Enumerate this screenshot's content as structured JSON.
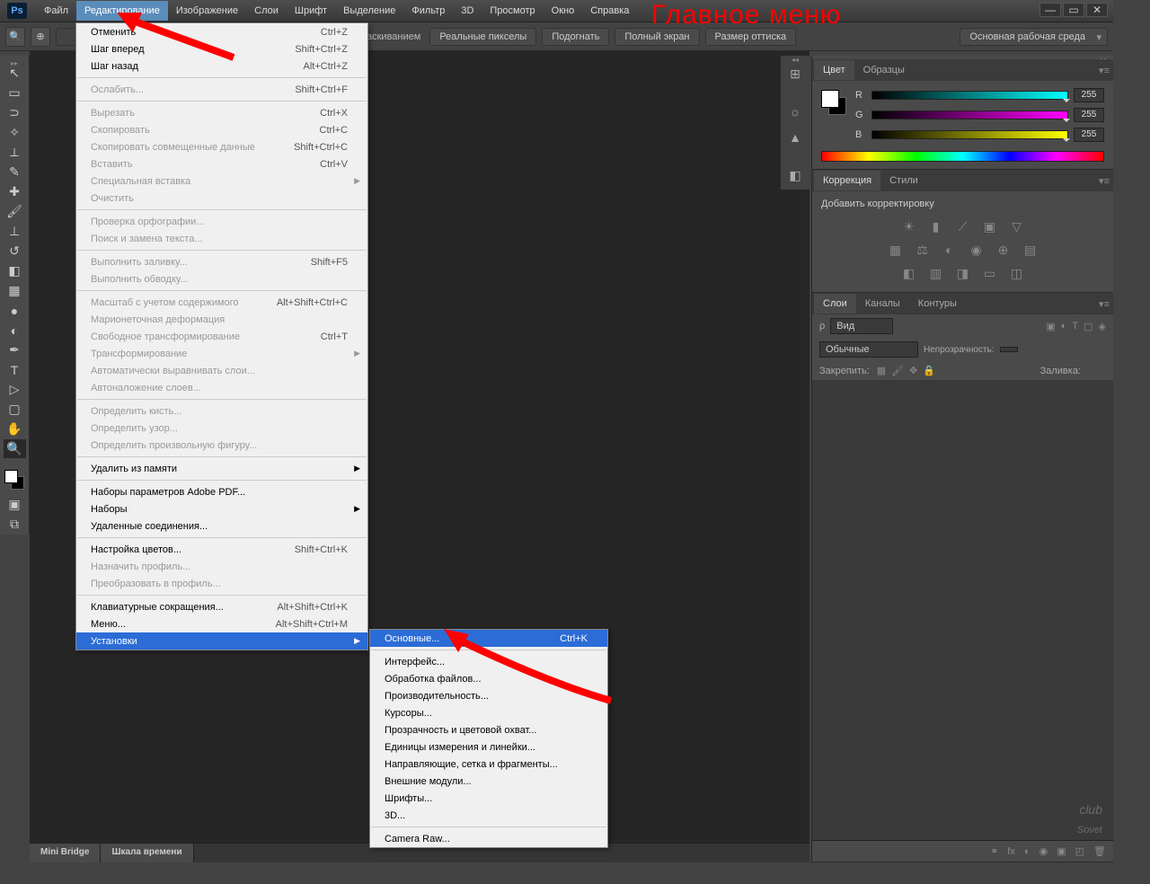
{
  "annotation": "Главное меню",
  "menubar": [
    "Файл",
    "Редактирование",
    "Изображение",
    "Слои",
    "Шрифт",
    "Выделение",
    "Фильтр",
    "3D",
    "Просмотр",
    "Окно",
    "Справка"
  ],
  "optbar": {
    "lbl1": "аскиванием",
    "btns": [
      "Реальные пикселы",
      "Подогнать",
      "Полный экран",
      "Размер оттиска"
    ],
    "workspace": "Основная рабочая среда"
  },
  "dropdown_edit": [
    {
      "t": "row",
      "label": "Отменить",
      "sc": "Ctrl+Z"
    },
    {
      "t": "row",
      "label": "Шаг вперед",
      "sc": "Shift+Ctrl+Z"
    },
    {
      "t": "row",
      "label": "Шаг назад",
      "sc": "Alt+Ctrl+Z"
    },
    {
      "t": "sep"
    },
    {
      "t": "row",
      "label": "Ослабить...",
      "sc": "Shift+Ctrl+F",
      "dis": true
    },
    {
      "t": "sep"
    },
    {
      "t": "row",
      "label": "Вырезать",
      "sc": "Ctrl+X",
      "dis": true
    },
    {
      "t": "row",
      "label": "Скопировать",
      "sc": "Ctrl+C",
      "dis": true
    },
    {
      "t": "row",
      "label": "Скопировать совмещенные данные",
      "sc": "Shift+Ctrl+C",
      "dis": true
    },
    {
      "t": "row",
      "label": "Вставить",
      "sc": "Ctrl+V",
      "dis": true
    },
    {
      "t": "row",
      "label": "Специальная вставка",
      "arr": true,
      "dis": true
    },
    {
      "t": "row",
      "label": "Очистить",
      "dis": true
    },
    {
      "t": "sep"
    },
    {
      "t": "row",
      "label": "Проверка орфографии...",
      "dis": true
    },
    {
      "t": "row",
      "label": "Поиск и замена текста...",
      "dis": true
    },
    {
      "t": "sep"
    },
    {
      "t": "row",
      "label": "Выполнить заливку...",
      "sc": "Shift+F5",
      "dis": true
    },
    {
      "t": "row",
      "label": "Выполнить обводку...",
      "dis": true
    },
    {
      "t": "sep"
    },
    {
      "t": "row",
      "label": "Масштаб с учетом содержимого",
      "sc": "Alt+Shift+Ctrl+C",
      "dis": true
    },
    {
      "t": "row",
      "label": "Марионеточная деформация",
      "dis": true
    },
    {
      "t": "row",
      "label": "Свободное трансформирование",
      "sc": "Ctrl+T",
      "dis": true
    },
    {
      "t": "row",
      "label": "Трансформирование",
      "arr": true,
      "dis": true
    },
    {
      "t": "row",
      "label": "Автоматически выравнивать слои...",
      "dis": true
    },
    {
      "t": "row",
      "label": "Автоналожение слоев...",
      "dis": true
    },
    {
      "t": "sep"
    },
    {
      "t": "row",
      "label": "Определить кисть...",
      "dis": true
    },
    {
      "t": "row",
      "label": "Определить узор...",
      "dis": true
    },
    {
      "t": "row",
      "label": "Определить произвольную фигуру...",
      "dis": true
    },
    {
      "t": "sep"
    },
    {
      "t": "row",
      "label": "Удалить из памяти",
      "arr": true
    },
    {
      "t": "sep"
    },
    {
      "t": "row",
      "label": "Наборы параметров Adobe PDF..."
    },
    {
      "t": "row",
      "label": "Наборы",
      "arr": true
    },
    {
      "t": "row",
      "label": "Удаленные соединения..."
    },
    {
      "t": "sep"
    },
    {
      "t": "row",
      "label": "Настройка цветов...",
      "sc": "Shift+Ctrl+K"
    },
    {
      "t": "row",
      "label": "Назначить профиль...",
      "dis": true
    },
    {
      "t": "row",
      "label": "Преобразовать в профиль...",
      "dis": true
    },
    {
      "t": "sep"
    },
    {
      "t": "row",
      "label": "Клавиатурные сокращения...",
      "sc": "Alt+Shift+Ctrl+K"
    },
    {
      "t": "row",
      "label": "Меню...",
      "sc": "Alt+Shift+Ctrl+M"
    },
    {
      "t": "row",
      "label": "Установки",
      "arr": true,
      "hl": true
    }
  ],
  "submenu_prefs": [
    {
      "t": "row",
      "label": "Основные...",
      "sc": "Ctrl+K",
      "hl": true
    },
    {
      "t": "sep"
    },
    {
      "t": "row",
      "label": "Интерфейс..."
    },
    {
      "t": "row",
      "label": "Обработка файлов..."
    },
    {
      "t": "row",
      "label": "Производительность..."
    },
    {
      "t": "row",
      "label": "Курсоры..."
    },
    {
      "t": "row",
      "label": "Прозрачность и цветовой охват..."
    },
    {
      "t": "row",
      "label": "Единицы измерения и линейки..."
    },
    {
      "t": "row",
      "label": "Направляющие, сетка и фрагменты..."
    },
    {
      "t": "row",
      "label": "Внешние модули..."
    },
    {
      "t": "row",
      "label": "Шрифты..."
    },
    {
      "t": "row",
      "label": "3D..."
    },
    {
      "t": "sep"
    },
    {
      "t": "row",
      "label": "Camera Raw..."
    }
  ],
  "panels": {
    "color_tab1": "Цвет",
    "color_tab2": "Образцы",
    "r": "R",
    "g": "G",
    "b": "B",
    "val": "255",
    "adj_tab1": "Коррекция",
    "adj_tab2": "Стили",
    "adj_text": "Добавить корректировку",
    "layers_tab1": "Слои",
    "layers_tab2": "Каналы",
    "layers_tab3": "Контуры",
    "kind": "Вид",
    "mode": "Обычные",
    "opacity": "Непрозрачность:",
    "lock": "Закрепить:",
    "fill": "Заливка:"
  },
  "tabs": {
    "mini": "Mini Bridge",
    "time": "Шкала времени"
  },
  "watermark": {
    "a": "club",
    "b": "Sovet"
  }
}
